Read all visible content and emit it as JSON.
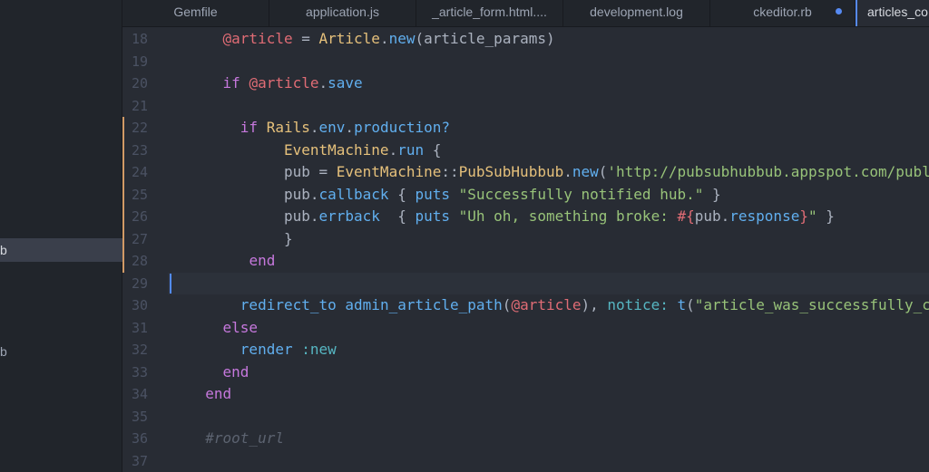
{
  "sidebar": {
    "items": [
      {
        "label": "b",
        "selected": true
      },
      {
        "label": "b",
        "selected": false
      }
    ]
  },
  "tabs": [
    {
      "label": "Gemfile"
    },
    {
      "label": "application.js"
    },
    {
      "label": "_article_form.html...."
    },
    {
      "label": "development.log"
    },
    {
      "label": "ckeditor.rb",
      "modified": true
    },
    {
      "label": "articles_co",
      "active": true
    }
  ],
  "editor": {
    "cursor_line": 29,
    "lines": [
      {
        "num": "18",
        "tokens": [
          [
            "    ",
            "pl"
          ],
          [
            "@article",
            "ivar"
          ],
          [
            " = ",
            "pl"
          ],
          [
            "Article",
            "cls"
          ],
          [
            ".",
            "pl"
          ],
          [
            "new",
            "fn"
          ],
          [
            "(article_params)",
            "pl"
          ]
        ]
      },
      {
        "num": "19",
        "tokens": []
      },
      {
        "num": "20",
        "tokens": [
          [
            "    ",
            "pl"
          ],
          [
            "if",
            "kw"
          ],
          [
            " ",
            "pl"
          ],
          [
            "@article",
            "ivar"
          ],
          [
            ".",
            "pl"
          ],
          [
            "save",
            "fn"
          ]
        ]
      },
      {
        "num": "21",
        "tokens": []
      },
      {
        "num": "22",
        "mod": true,
        "tokens": [
          [
            "      ",
            "pl"
          ],
          [
            "if",
            "kw"
          ],
          [
            " ",
            "pl"
          ],
          [
            "Rails",
            "cls"
          ],
          [
            ".",
            "pl"
          ],
          [
            "env",
            "fn"
          ],
          [
            ".",
            "pl"
          ],
          [
            "production?",
            "fn"
          ]
        ]
      },
      {
        "num": "23",
        "mod": true,
        "tokens": [
          [
            "           ",
            "pl"
          ],
          [
            "EventMachine",
            "cls"
          ],
          [
            ".",
            "pl"
          ],
          [
            "run",
            "fn"
          ],
          [
            " {",
            "pl"
          ]
        ]
      },
      {
        "num": "24",
        "mod": true,
        "tokens": [
          [
            "           ",
            "pl"
          ],
          [
            "pub = ",
            "pl"
          ],
          [
            "EventMachine",
            "cls"
          ],
          [
            "::",
            "pl"
          ],
          [
            "PubSubHubbub",
            "cls"
          ],
          [
            ".",
            "pl"
          ],
          [
            "new",
            "fn"
          ],
          [
            "(",
            "pl"
          ],
          [
            "'http://pubsubhubbub.appspot.com/publ",
            "str"
          ]
        ]
      },
      {
        "num": "25",
        "mod": true,
        "tokens": [
          [
            "           ",
            "pl"
          ],
          [
            "pub.",
            "pl"
          ],
          [
            "callback",
            "fn"
          ],
          [
            " { ",
            "pl"
          ],
          [
            "puts",
            "fn"
          ],
          [
            " ",
            "pl"
          ],
          [
            "\"Successfully notified hub.\"",
            "str"
          ],
          [
            " }",
            "pl"
          ]
        ]
      },
      {
        "num": "26",
        "mod": true,
        "tokens": [
          [
            "           ",
            "pl"
          ],
          [
            "pub.",
            "pl"
          ],
          [
            "errback",
            "fn"
          ],
          [
            "  { ",
            "pl"
          ],
          [
            "puts",
            "fn"
          ],
          [
            " ",
            "pl"
          ],
          [
            "\"Uh oh, something broke: ",
            "str"
          ],
          [
            "#{",
            "ivar"
          ],
          [
            "pub.",
            "pl"
          ],
          [
            "response",
            "fn"
          ],
          [
            "}",
            "ivar"
          ],
          [
            "\"",
            "str"
          ],
          [
            " }",
            "pl"
          ]
        ]
      },
      {
        "num": "27",
        "mod": true,
        "tokens": [
          [
            "           ",
            "pl"
          ],
          [
            "}",
            "pl"
          ]
        ]
      },
      {
        "num": "28",
        "mod": true,
        "tokens": [
          [
            "       ",
            "pl"
          ],
          [
            "end",
            "kw"
          ]
        ]
      },
      {
        "num": "29",
        "tokens": []
      },
      {
        "num": "30",
        "tokens": [
          [
            "      ",
            "pl"
          ],
          [
            "redirect_to",
            "fn"
          ],
          [
            " ",
            "pl"
          ],
          [
            "admin_article_path",
            "fn"
          ],
          [
            "(",
            "pl"
          ],
          [
            "@article",
            "ivar"
          ],
          [
            "), ",
            "pl"
          ],
          [
            "notice:",
            "sym"
          ],
          [
            " ",
            "pl"
          ],
          [
            "t",
            "fn"
          ],
          [
            "(",
            "pl"
          ],
          [
            "\"article_was_successfully_c",
            "str"
          ]
        ]
      },
      {
        "num": "31",
        "tokens": [
          [
            "    ",
            "pl"
          ],
          [
            "else",
            "kw"
          ]
        ]
      },
      {
        "num": "32",
        "tokens": [
          [
            "      ",
            "pl"
          ],
          [
            "render",
            "fn"
          ],
          [
            " ",
            "pl"
          ],
          [
            ":new",
            "sym"
          ]
        ]
      },
      {
        "num": "33",
        "tokens": [
          [
            "    ",
            "pl"
          ],
          [
            "end",
            "kw"
          ]
        ]
      },
      {
        "num": "34",
        "tokens": [
          [
            "  ",
            "pl"
          ],
          [
            "end",
            "kw"
          ]
        ]
      },
      {
        "num": "35",
        "tokens": []
      },
      {
        "num": "36",
        "tokens": [
          [
            "  ",
            "pl"
          ],
          [
            "#root_url",
            "cm"
          ]
        ]
      },
      {
        "num": "37",
        "tokens": []
      }
    ]
  }
}
